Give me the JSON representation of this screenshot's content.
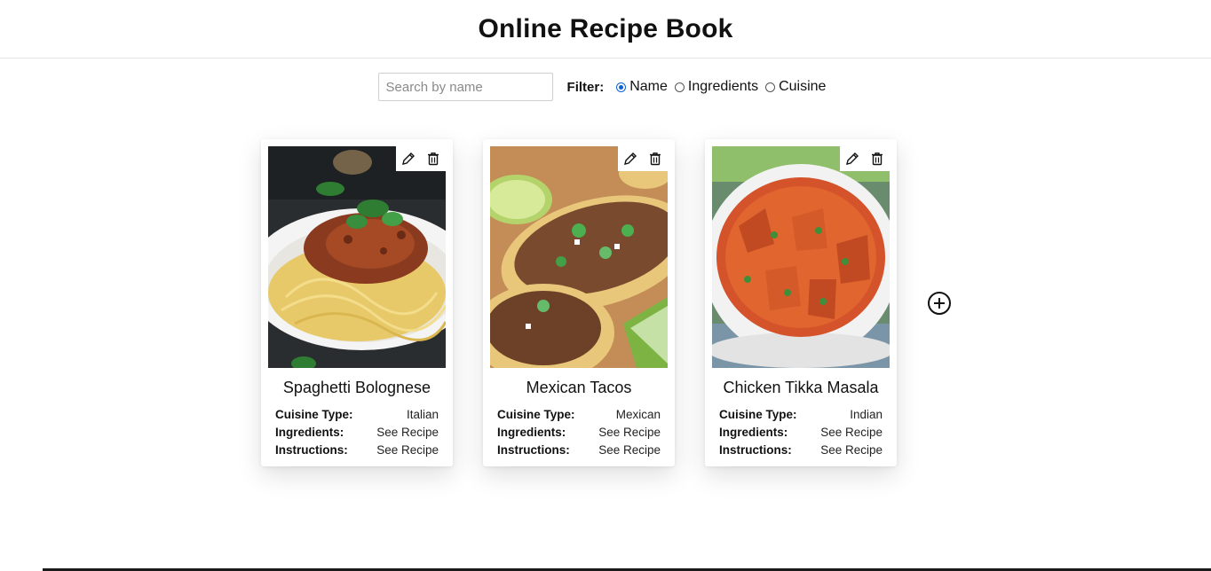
{
  "app": {
    "title": "Online Recipe Book"
  },
  "search": {
    "placeholder": "Search by name",
    "value": ""
  },
  "filter": {
    "label": "Filter:",
    "options": [
      "Name",
      "Ingredients",
      "Cuisine"
    ],
    "selected": "Name"
  },
  "cards": [
    {
      "title": "Spaghetti Bolognese",
      "rows": [
        {
          "key": "Cuisine Type:",
          "value": "Italian"
        },
        {
          "key": "Ingredients:",
          "value": "See Recipe"
        },
        {
          "key": "Instructions:",
          "value": "See Recipe"
        }
      ],
      "image": "spaghetti-bolognese-photo"
    },
    {
      "title": "Mexican Tacos",
      "rows": [
        {
          "key": "Cuisine Type:",
          "value": "Mexican"
        },
        {
          "key": "Ingredients:",
          "value": "See Recipe"
        },
        {
          "key": "Instructions:",
          "value": "See Recipe"
        }
      ],
      "image": "mexican-tacos-photo"
    },
    {
      "title": "Chicken Tikka Masala",
      "rows": [
        {
          "key": "Cuisine Type:",
          "value": "Indian"
        },
        {
          "key": "Ingredients:",
          "value": "See Recipe"
        },
        {
          "key": "Instructions:",
          "value": "See Recipe"
        }
      ],
      "image": "chicken-tikka-masala-photo"
    }
  ],
  "icons": {
    "edit": "pencil-icon",
    "delete": "trash-icon",
    "add": "plus-circle-icon"
  },
  "colors": {
    "accent": "#0b63ce"
  }
}
